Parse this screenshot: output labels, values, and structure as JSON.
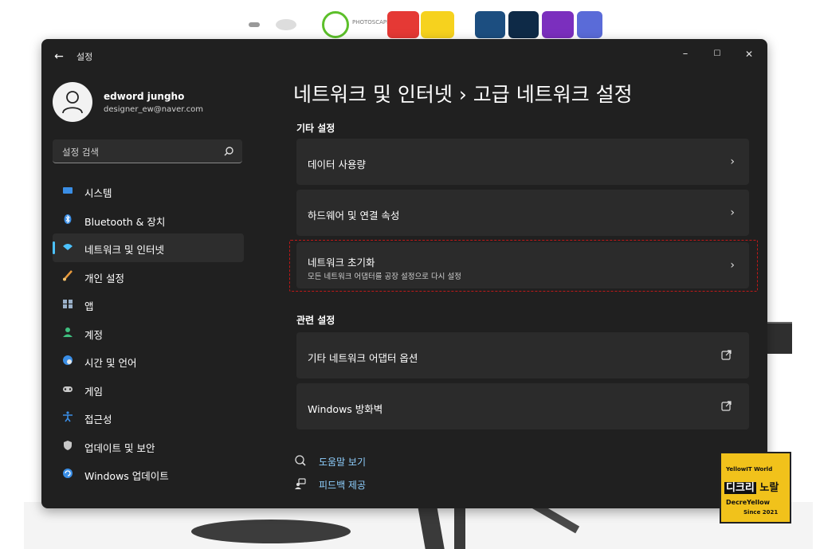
{
  "desktop": {
    "app_label": "PHOTOSCAPE"
  },
  "window": {
    "app_title": "설정",
    "back_icon": "←",
    "minimize_icon": "–",
    "maximize_icon": "☐",
    "close_icon": "✕"
  },
  "profile": {
    "name": "edword jungho",
    "email": "designer_ew@naver.com"
  },
  "search": {
    "placeholder": "설정 검색"
  },
  "sidebar": {
    "items": [
      {
        "label": "시스템",
        "icon": "monitor-icon",
        "color": "#3a8ee6"
      },
      {
        "label": "Bluetooth & 장치",
        "icon": "bluetooth-icon",
        "color": "#3a8ee6"
      },
      {
        "label": "네트워크 및 인터넷",
        "icon": "wifi-icon",
        "color": "#4cc2ff",
        "selected": true
      },
      {
        "label": "개인 설정",
        "icon": "brush-icon",
        "color": "#e89a3c"
      },
      {
        "label": "앱",
        "icon": "apps-icon",
        "color": "#9ab0c8"
      },
      {
        "label": "계정",
        "icon": "person-icon",
        "color": "#3fbf7f"
      },
      {
        "label": "시간 및 언어",
        "icon": "globe-clock-icon",
        "color": "#3a8ee6"
      },
      {
        "label": "게임",
        "icon": "gamepad-icon",
        "color": "#c8c8c8"
      },
      {
        "label": "접근성",
        "icon": "accessibility-icon",
        "color": "#3a8ee6"
      },
      {
        "label": "업데이트 및 보안",
        "icon": "shield-icon",
        "color": "#c8c8c8"
      },
      {
        "label": "Windows 업데이트",
        "icon": "update-icon",
        "color": "#3a8ee6"
      }
    ]
  },
  "content": {
    "title": "네트워크 및 인터넷 › 고급 네트워크 설정",
    "section_other": "기타 설정",
    "cards_other": [
      {
        "title": "데이터 사용량"
      },
      {
        "title": "하드웨어 및 연결 속성"
      },
      {
        "title": "네트워크 초기화",
        "subtitle": "모든 네트워크 어댑터를 공장 설정으로 다시 설정"
      }
    ],
    "section_related": "관련 설정",
    "cards_related": [
      {
        "title": "기타 네트워크 어댑터 옵션"
      },
      {
        "title": "Windows 방화벽"
      }
    ],
    "help_links": [
      {
        "label": "도움말 보기",
        "icon": "help-icon"
      },
      {
        "label": "피드백 제공",
        "icon": "feedback-icon"
      }
    ],
    "chevron": "›"
  },
  "watermark": {
    "top": "YellowIT World",
    "main_dark": "디크리",
    "main_light": "노랄",
    "brand": "DecreYellow",
    "since": "Since 2021"
  }
}
